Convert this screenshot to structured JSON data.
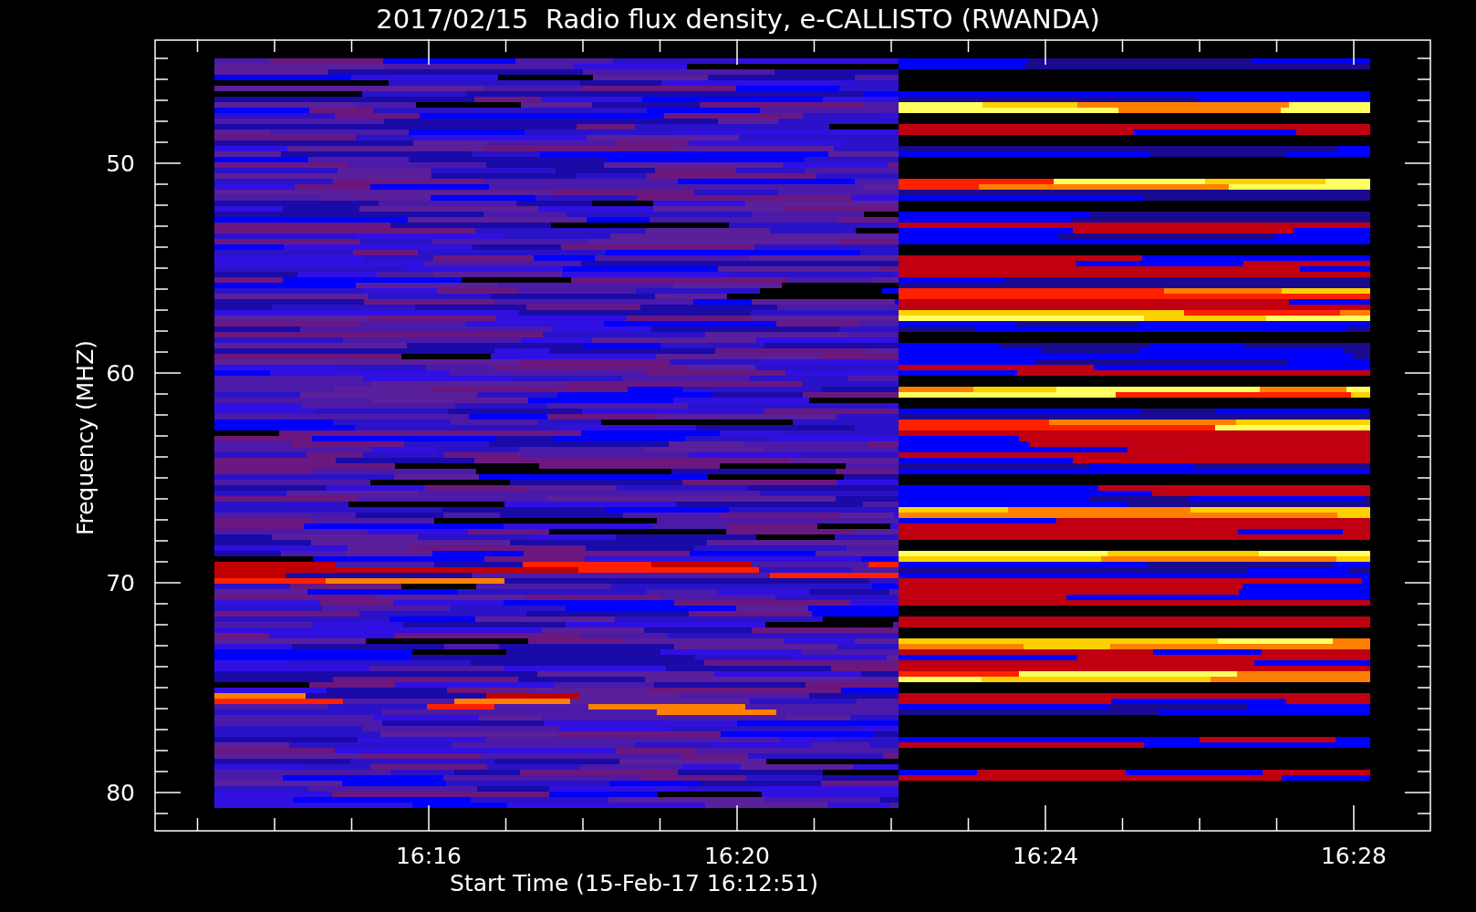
{
  "title": "2017/02/15  Radio flux density, e-CALLISTO (RWANDA)",
  "ylabel": "Frequency (MHZ)",
  "xlabel": "Start Time (15-Feb-17 16:12:51)",
  "yticks": [
    "50",
    "60",
    "70",
    "80"
  ],
  "xticks": [
    "16:16",
    "16:20",
    "16:24",
    "16:28"
  ]
}
